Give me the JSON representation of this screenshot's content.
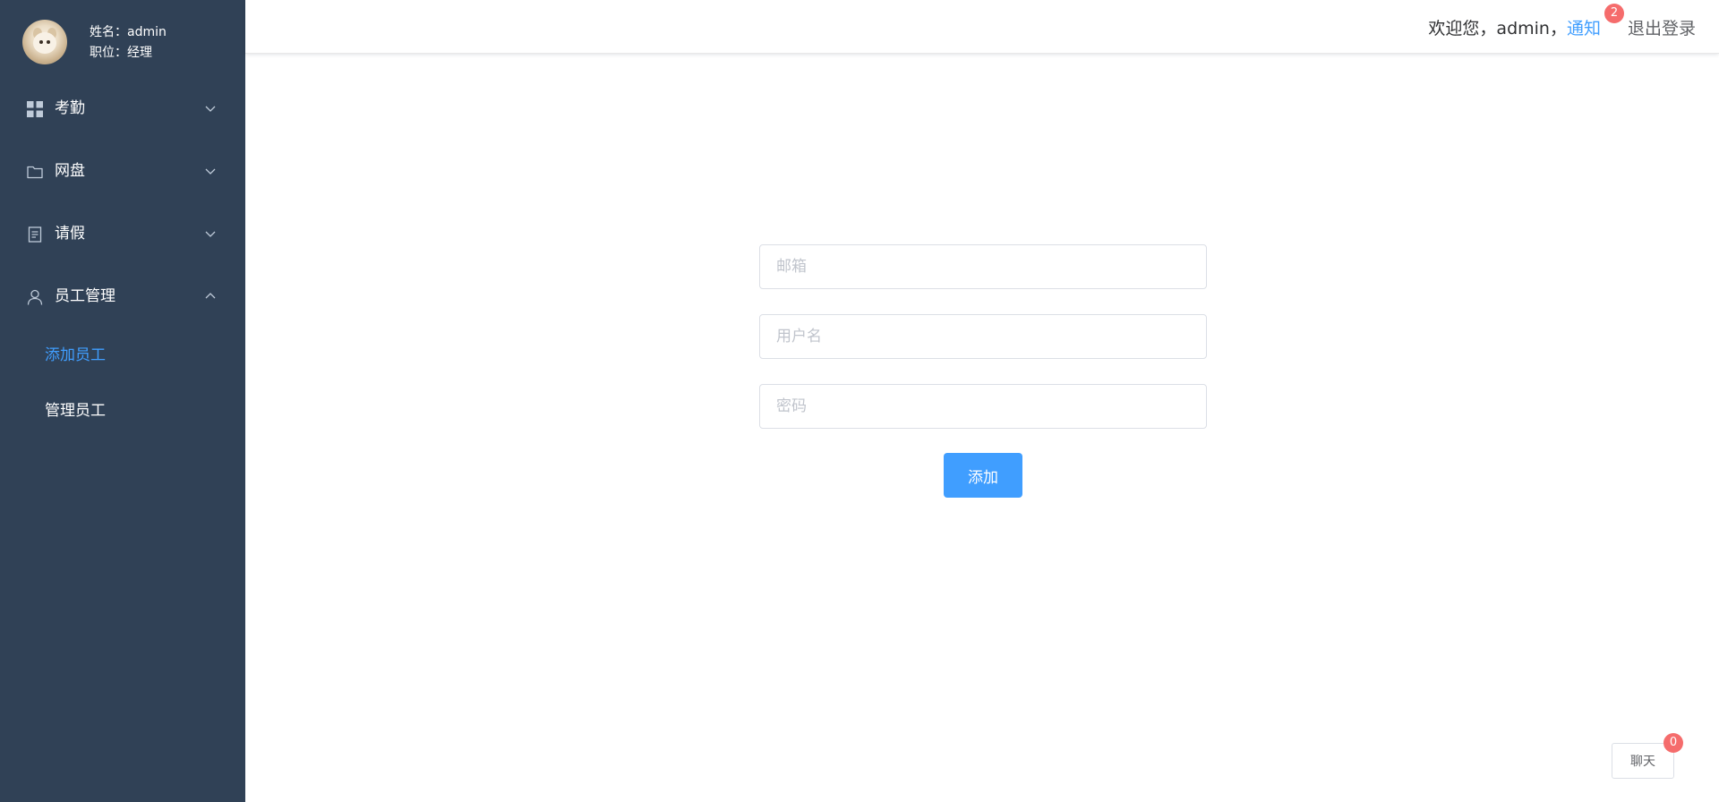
{
  "profile": {
    "name_line": "姓名：admin",
    "position_line": "职位：经理",
    "avatar_icon": "cat-avatar-icon"
  },
  "sidebar": {
    "items": [
      {
        "label": "考勤",
        "icon": "grid-icon",
        "arrow": "chevron-down",
        "expanded": false
      },
      {
        "label": "网盘",
        "icon": "folder-icon",
        "arrow": "chevron-down",
        "expanded": false
      },
      {
        "label": "请假",
        "icon": "document-icon",
        "arrow": "chevron-down",
        "expanded": false
      },
      {
        "label": "员工管理",
        "icon": "user-icon",
        "arrow": "chevron-up",
        "expanded": true,
        "children": [
          {
            "label": "添加员工",
            "active": true
          },
          {
            "label": "管理员工",
            "active": false
          }
        ]
      }
    ]
  },
  "header": {
    "welcome": "欢迎您，admin，",
    "notify_label": "通知",
    "notify_count": "2",
    "logout_label": "退出登录"
  },
  "form": {
    "email_placeholder": "邮箱",
    "username_placeholder": "用户名",
    "password_placeholder": "密码",
    "email_value": "",
    "username_value": "",
    "password_value": "",
    "submit_label": "添加"
  },
  "chat": {
    "label": "聊天",
    "count": "0"
  },
  "colors": {
    "sidebar_bg": "#304156",
    "accent": "#409eff",
    "badge": "#f56c6c",
    "menu_icon": "#bfcbd9"
  }
}
